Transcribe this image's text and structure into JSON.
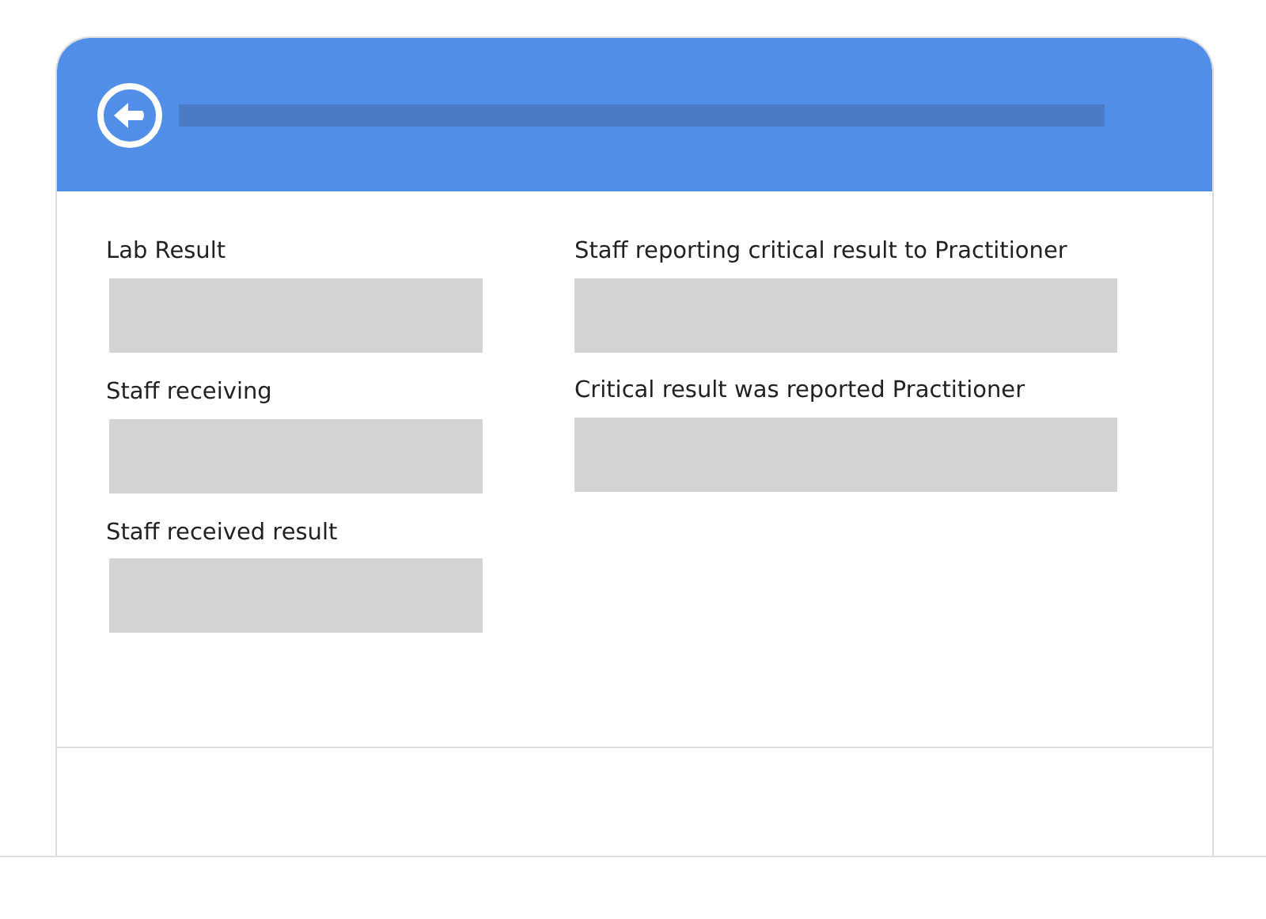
{
  "columns": [
    {
      "fields": [
        {
          "label": "Lab Result"
        },
        {
          "label": "Staff receiving"
        },
        {
          "label": "Staff received result"
        }
      ]
    },
    {
      "fields": [
        {
          "label": "Staff reporting critical result to Practitioner"
        },
        {
          "label": "Critical result was reported Practitioner"
        }
      ]
    }
  ]
}
